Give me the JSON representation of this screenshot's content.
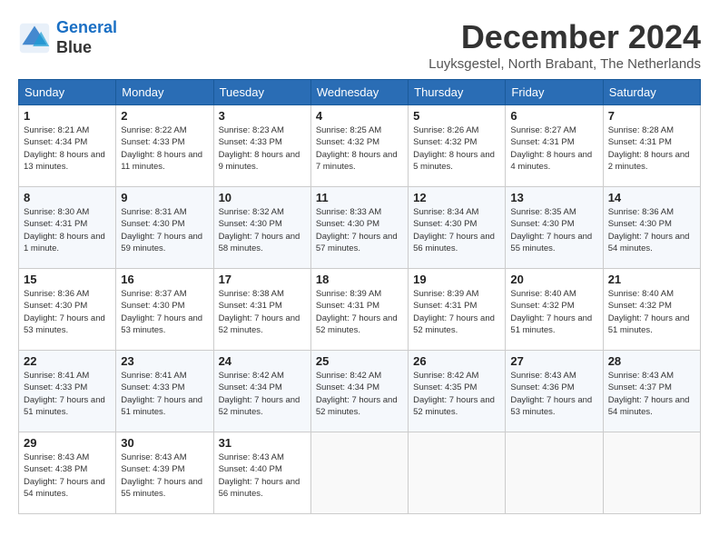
{
  "logo": {
    "line1": "General",
    "line2": "Blue"
  },
  "title": "December 2024",
  "location": "Luyksgestel, North Brabant, The Netherlands",
  "days_of_week": [
    "Sunday",
    "Monday",
    "Tuesday",
    "Wednesday",
    "Thursday",
    "Friday",
    "Saturday"
  ],
  "weeks": [
    [
      {
        "day": "1",
        "sunrise": "8:21 AM",
        "sunset": "4:34 PM",
        "daylight": "8 hours and 13 minutes."
      },
      {
        "day": "2",
        "sunrise": "8:22 AM",
        "sunset": "4:33 PM",
        "daylight": "8 hours and 11 minutes."
      },
      {
        "day": "3",
        "sunrise": "8:23 AM",
        "sunset": "4:33 PM",
        "daylight": "8 hours and 9 minutes."
      },
      {
        "day": "4",
        "sunrise": "8:25 AM",
        "sunset": "4:32 PM",
        "daylight": "8 hours and 7 minutes."
      },
      {
        "day": "5",
        "sunrise": "8:26 AM",
        "sunset": "4:32 PM",
        "daylight": "8 hours and 5 minutes."
      },
      {
        "day": "6",
        "sunrise": "8:27 AM",
        "sunset": "4:31 PM",
        "daylight": "8 hours and 4 minutes."
      },
      {
        "day": "7",
        "sunrise": "8:28 AM",
        "sunset": "4:31 PM",
        "daylight": "8 hours and 2 minutes."
      }
    ],
    [
      {
        "day": "8",
        "sunrise": "8:30 AM",
        "sunset": "4:31 PM",
        "daylight": "8 hours and 1 minute."
      },
      {
        "day": "9",
        "sunrise": "8:31 AM",
        "sunset": "4:30 PM",
        "daylight": "7 hours and 59 minutes."
      },
      {
        "day": "10",
        "sunrise": "8:32 AM",
        "sunset": "4:30 PM",
        "daylight": "7 hours and 58 minutes."
      },
      {
        "day": "11",
        "sunrise": "8:33 AM",
        "sunset": "4:30 PM",
        "daylight": "7 hours and 57 minutes."
      },
      {
        "day": "12",
        "sunrise": "8:34 AM",
        "sunset": "4:30 PM",
        "daylight": "7 hours and 56 minutes."
      },
      {
        "day": "13",
        "sunrise": "8:35 AM",
        "sunset": "4:30 PM",
        "daylight": "7 hours and 55 minutes."
      },
      {
        "day": "14",
        "sunrise": "8:36 AM",
        "sunset": "4:30 PM",
        "daylight": "7 hours and 54 minutes."
      }
    ],
    [
      {
        "day": "15",
        "sunrise": "8:36 AM",
        "sunset": "4:30 PM",
        "daylight": "7 hours and 53 minutes."
      },
      {
        "day": "16",
        "sunrise": "8:37 AM",
        "sunset": "4:30 PM",
        "daylight": "7 hours and 53 minutes."
      },
      {
        "day": "17",
        "sunrise": "8:38 AM",
        "sunset": "4:31 PM",
        "daylight": "7 hours and 52 minutes."
      },
      {
        "day": "18",
        "sunrise": "8:39 AM",
        "sunset": "4:31 PM",
        "daylight": "7 hours and 52 minutes."
      },
      {
        "day": "19",
        "sunrise": "8:39 AM",
        "sunset": "4:31 PM",
        "daylight": "7 hours and 52 minutes."
      },
      {
        "day": "20",
        "sunrise": "8:40 AM",
        "sunset": "4:32 PM",
        "daylight": "7 hours and 51 minutes."
      },
      {
        "day": "21",
        "sunrise": "8:40 AM",
        "sunset": "4:32 PM",
        "daylight": "7 hours and 51 minutes."
      }
    ],
    [
      {
        "day": "22",
        "sunrise": "8:41 AM",
        "sunset": "4:33 PM",
        "daylight": "7 hours and 51 minutes."
      },
      {
        "day": "23",
        "sunrise": "8:41 AM",
        "sunset": "4:33 PM",
        "daylight": "7 hours and 51 minutes."
      },
      {
        "day": "24",
        "sunrise": "8:42 AM",
        "sunset": "4:34 PM",
        "daylight": "7 hours and 52 minutes."
      },
      {
        "day": "25",
        "sunrise": "8:42 AM",
        "sunset": "4:34 PM",
        "daylight": "7 hours and 52 minutes."
      },
      {
        "day": "26",
        "sunrise": "8:42 AM",
        "sunset": "4:35 PM",
        "daylight": "7 hours and 52 minutes."
      },
      {
        "day": "27",
        "sunrise": "8:43 AM",
        "sunset": "4:36 PM",
        "daylight": "7 hours and 53 minutes."
      },
      {
        "day": "28",
        "sunrise": "8:43 AM",
        "sunset": "4:37 PM",
        "daylight": "7 hours and 54 minutes."
      }
    ],
    [
      {
        "day": "29",
        "sunrise": "8:43 AM",
        "sunset": "4:38 PM",
        "daylight": "7 hours and 54 minutes."
      },
      {
        "day": "30",
        "sunrise": "8:43 AM",
        "sunset": "4:39 PM",
        "daylight": "7 hours and 55 minutes."
      },
      {
        "day": "31",
        "sunrise": "8:43 AM",
        "sunset": "4:40 PM",
        "daylight": "7 hours and 56 minutes."
      },
      null,
      null,
      null,
      null
    ]
  ]
}
